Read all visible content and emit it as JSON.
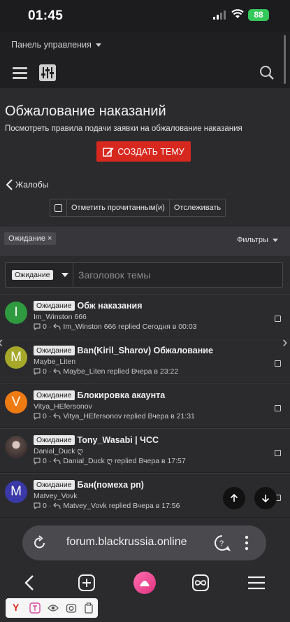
{
  "status_bar": {
    "time": "01:45",
    "battery": "88"
  },
  "nav": {
    "panel_label": "Панель управления"
  },
  "header": {
    "title": "Обжалование наказаний",
    "description": "Посмотреть правила подачи заявки на обжалование наказания",
    "create_button": "СОЗДАТЬ ТЕМУ",
    "back_link": "Жалобы",
    "mark_read": "Отметить прочитанным(и)",
    "watch": "Отслеживать"
  },
  "filters": {
    "chip": "Ожидание ×",
    "filters_button": "Фильтры",
    "prefix_select": "Ожидание",
    "title_placeholder": "Заголовок темы"
  },
  "threads": [
    {
      "avatar_letter": "I",
      "avatar_color": "#2f9a3f",
      "prefix": "Ожидание",
      "title": "Обж наказания",
      "author": "Im_Winston 666",
      "replies": "0",
      "last_reply": "Im_Winston 666 replied Сегодня в 00:03"
    },
    {
      "avatar_letter": "M",
      "avatar_color": "#a6a82a",
      "prefix": "Ожидание",
      "title": "Ban(Kiril_Sharov) Обжалование",
      "author": "Maybe_Liten",
      "replies": "0",
      "last_reply": "Maybe_Liten replied Вчера в 23:22"
    },
    {
      "avatar_letter": "V",
      "avatar_color": "#ee7a12",
      "prefix": "Ожидание",
      "title": "Блокировка акаунта",
      "author": "Vitya_HEfersonov",
      "replies": "0",
      "last_reply": "Vitya_HEfersonov replied Вчера в 21:31"
    },
    {
      "avatar_letter": "",
      "avatar_color": "#3a3030",
      "prefix": "Ожидание",
      "title": "Tony_Wasabi | ЧСС",
      "author": "Danial_Duck ღ",
      "replies": "0",
      "last_reply": "Danial_Duck ღ replied Вчера в 17:57"
    },
    {
      "avatar_letter": "M",
      "avatar_color": "#3b39a8",
      "prefix": "Ожидание",
      "title": "Бан(помеха рп)",
      "author": "Matvey_Vovk",
      "replies": "0",
      "last_reply": "Matvey_Vovk replied Вчера в 17:56"
    }
  ],
  "browser": {
    "url": "forum.blackrussia.online",
    "mini_bar_logo": "Y"
  }
}
